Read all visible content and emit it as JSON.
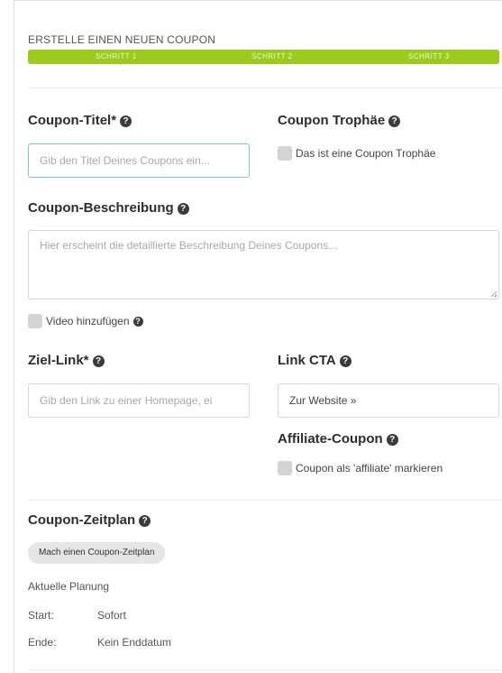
{
  "header": {
    "title": "ERSTELLE EINEN NEUEN COUPON"
  },
  "steps": [
    "SCHRITT 1",
    "SCHRITT 2",
    "SCHRITT 3"
  ],
  "fields": {
    "title_label": "Coupon-Titel*",
    "title_placeholder": "Gib den Titel Deines Coupons ein...",
    "trophy_label": "Coupon Trophäe",
    "trophy_checkbox": "Das ist eine Coupon Trophäe",
    "description_label": "Coupon-Beschreibung",
    "description_placeholder": "Hier erscheint die detaillierte Beschreibung Deines Coupons...",
    "video_checkbox": "Video hinzufügen",
    "target_label": "Ziel-Link*",
    "target_placeholder": "Gib den Link zu einer Homepage, ei",
    "cta_label": "Link CTA",
    "cta_value": "Zur Website »",
    "affiliate_label": "Affiliate-Coupon",
    "affiliate_checkbox": "Coupon als 'affiliate' markieren"
  },
  "schedule": {
    "title": "Coupon-Zeitplan",
    "button": "Mach einen Coupon-Zeitplan",
    "current": "Aktuelle Planung",
    "start_label": "Start:",
    "start_value": "Sofort",
    "end_label": "Ende:",
    "end_value": "Kein Enddatum"
  },
  "colors": {
    "progress": "#9ccb1d",
    "focus_border": "#7dc4da"
  }
}
